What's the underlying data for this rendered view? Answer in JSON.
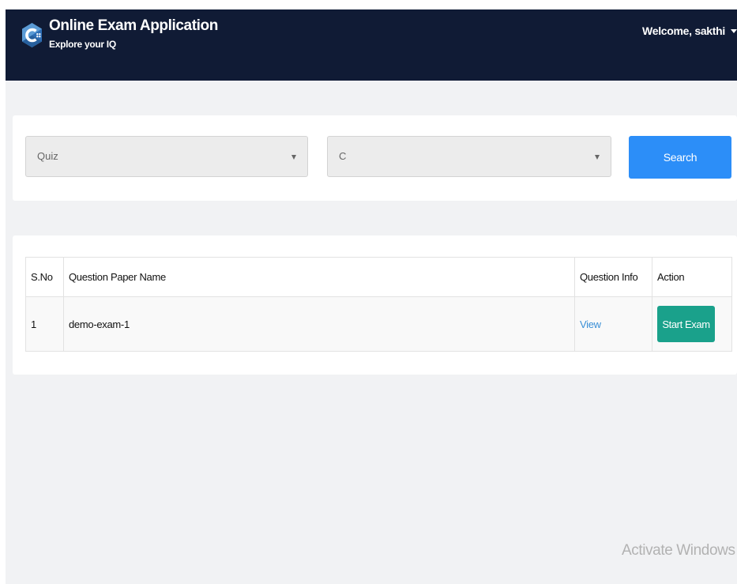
{
  "colors": {
    "navbar": "#101b35",
    "primary_button": "#2c8ef8",
    "success_button": "#1aa18b",
    "link": "#3a8fd6",
    "page_background": "#f1f2f4"
  },
  "navbar": {
    "logo_icon": "c-language-logo-icon",
    "title": "Online Exam Application",
    "subtitle": "Explore your IQ",
    "welcome": "Welcome, sakthi",
    "caret_icon": "caret-down-icon"
  },
  "filters": {
    "category": {
      "selected": "Quiz"
    },
    "subject": {
      "selected": "C"
    },
    "search_label": "Search"
  },
  "table": {
    "headers": {
      "sno": "S.No",
      "name": "Question Paper Name",
      "info": "Question Info",
      "action": "Action"
    },
    "rows": [
      {
        "sno": "1",
        "name": "demo-exam-1",
        "info_link": "View",
        "action_label": "Start Exam"
      }
    ]
  },
  "watermark": "Activate Windows"
}
